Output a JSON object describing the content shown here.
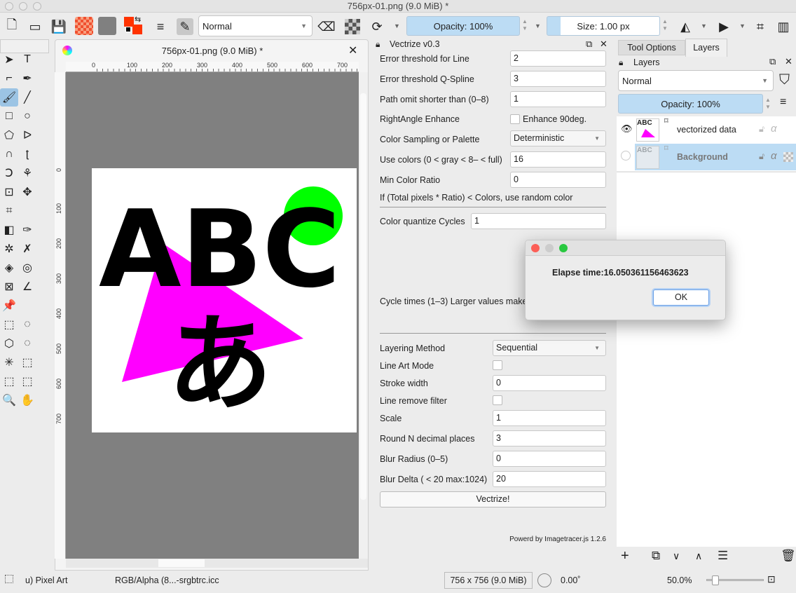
{
  "window": {
    "title": "756px-01.png (9.0 MiB) *"
  },
  "toolbar": {
    "blend_mode": "Normal",
    "opacity": "Opacity: 100%",
    "size": "Size: 1.00 px",
    "colors": {
      "foreground": "#ff3300",
      "background": "#ff3300"
    }
  },
  "document": {
    "tab_title": "756px-01.png (9.0 MiB) *",
    "ruler_ticks": [
      "0",
      "100",
      "200",
      "300",
      "400",
      "500",
      "600",
      "700"
    ],
    "vruler_ticks": [
      "0",
      "100",
      "200",
      "300",
      "400",
      "500",
      "600",
      "700"
    ],
    "image": {
      "text_latin": "ABC",
      "text_kana": "あ",
      "colors": {
        "triangle": "#ff00ff",
        "circle": "#00ff00"
      }
    }
  },
  "vectrize": {
    "title": "Vectrize v0.3",
    "fields": [
      {
        "label": "Error threshold for Line",
        "value": "2"
      },
      {
        "label": "Error threshold Q-Spline",
        "value": "3"
      },
      {
        "label": "Path omit shorter than (0–8)",
        "value": "1"
      }
    ],
    "right_angle": {
      "label": "RightAngle Enhance",
      "checkbox_label": "Enhance 90deg.",
      "checked": false
    },
    "color_sampling": {
      "label": "Color Sampling or Palette",
      "value": "Deterministic"
    },
    "use_colors": {
      "label": "Use colors (0 < gray < 8– < full)",
      "value": "16"
    },
    "min_color_ratio": {
      "label": "Min Color Ratio",
      "value": "0"
    },
    "ratio_note": "If (Total pixels * Ratio) < Colors,  use random color",
    "quantize": {
      "label": "Color quantize Cycles",
      "value": "1"
    },
    "cycle_note": "Cycle times (1–3) Larger values make",
    "layering": {
      "label": "Layering Method",
      "value": "Sequential"
    },
    "line_art": {
      "label": "Line Art Mode",
      "checked": false
    },
    "stroke_width": {
      "label": "Stroke width",
      "value": "0"
    },
    "line_remove": {
      "label": "Line remove filter",
      "checked": false
    },
    "scale": {
      "label": "Scale",
      "value": "1"
    },
    "round": {
      "label": "Round N decimal places",
      "value": "3"
    },
    "blur_radius": {
      "label": "Blur Radius (0–5)",
      "value": "0"
    },
    "blur_delta": {
      "label": "Blur Delta ( < 20 max:1024)",
      "value": "20"
    },
    "button": "Vectrize!",
    "footer": "Powerd by Imagetracer.js 1.2.6"
  },
  "layers": {
    "tabs": [
      "Tool Options",
      "Layers"
    ],
    "active_tab": "Layers",
    "title": "Layers",
    "blend_mode": "Normal",
    "opacity": "Opacity:  100%",
    "items": [
      {
        "name": "vectorized data",
        "visible": true,
        "selected": false
      },
      {
        "name": "Background",
        "visible": false,
        "selected": true
      }
    ]
  },
  "dialog": {
    "message": "Elapse time:16.050361156463623",
    "ok": "OK"
  },
  "status": {
    "brush": "u) Pixel Art",
    "color_space": "RGB/Alpha (8...-srgbtrc.icc",
    "dimensions": "756 x 756 (9.0 MiB)",
    "rotation": "0.00˚",
    "zoom": "50.0%",
    "zoom_fraction": 0.1
  }
}
